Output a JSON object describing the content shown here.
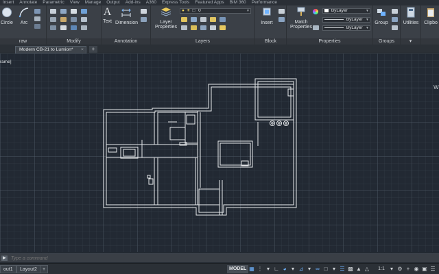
{
  "ribbon_tabs": [
    "Insert",
    "Annotate",
    "Parametric",
    "View",
    "Manage",
    "Output",
    "Add-ins",
    "A360",
    "Express Tools",
    "Featured Apps",
    "BIM 360",
    "Performance"
  ],
  "panels": {
    "draw": {
      "title": "raw",
      "circle": "Circle",
      "arc": "Arc"
    },
    "modify": {
      "title": "Modify"
    },
    "annotation": {
      "title": "Annotation",
      "text": "Text",
      "dimension": "Dimension"
    },
    "layers": {
      "title": "Layers",
      "layer_properties_line1": "Layer",
      "layer_properties_line2": "Properties",
      "current_layer": "0"
    },
    "block": {
      "title": "Block",
      "insert": "Insert"
    },
    "properties": {
      "title": "Properties",
      "match_line1": "Match",
      "match_line2": "Properties",
      "color": "ByLayer",
      "linetype": "ByLayer",
      "lineweight": "ByLayer"
    },
    "groups": {
      "title": "Groups",
      "group": "Group"
    },
    "utilities": {
      "utilities": "Utilities"
    },
    "clipboard": {
      "clipboard": "Clipbo"
    }
  },
  "file_tabs": {
    "document": "Modern CB-21 to Lumion*",
    "new_tab": "+"
  },
  "viewport_label": "rame]",
  "viewcube_hint": "W",
  "command": {
    "placeholder": "Type a command"
  },
  "layouts": [
    "out1",
    "Layout2"
  ],
  "add_layout": "+",
  "status": {
    "model": "MODEL",
    "scale": "1:1"
  },
  "colors": {
    "ribbon_bg": "#3b4047",
    "canvas_bg": "#222933",
    "linework": "#e8eaec",
    "accent": "#6fb3ff"
  }
}
